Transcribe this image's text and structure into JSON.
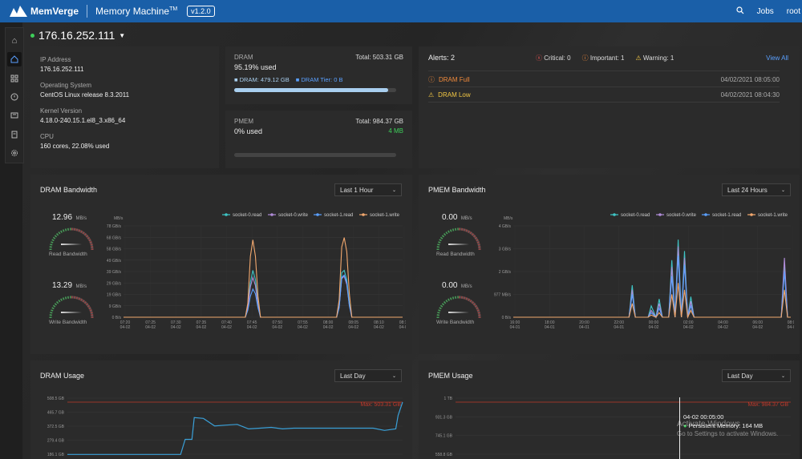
{
  "topbar": {
    "brand": "MemVerge",
    "app": "Memory Machine",
    "tm": "TM",
    "version": "v1.2.0",
    "jobs": "Jobs",
    "user": "root"
  },
  "host": {
    "ip": "176.16.252.111"
  },
  "info": {
    "ip_label": "IP Address",
    "ip": "176.16.252.111",
    "os_label": "Operating System",
    "os": "CentOS Linux release 8.3.2011",
    "kernel_label": "Kernel Version",
    "kernel": "4.18.0-240.15.1.el8_3.x86_64",
    "cpu_label": "CPU",
    "cpu": "160 cores, 22.08% used"
  },
  "dram": {
    "label": "DRAM",
    "total": "Total: 503.31 GB",
    "used": "95.19% used",
    "dram_leg": "DRAM: 479.12 GB",
    "tier_leg": "DRAM Tier: 0 B",
    "fill": 0.9519
  },
  "pmem": {
    "label": "PMEM",
    "total": "Total: 984.37 GB",
    "used": "0% used",
    "free": "4 MB",
    "fill": 0.0
  },
  "alerts": {
    "title": "Alerts: 2",
    "critical": "Critical: 0",
    "important": "Important: 1",
    "warning": "Warning: 1",
    "view_all": "View All",
    "items": [
      {
        "name": "DRAM Full",
        "time": "04/02/2021 08:05:00"
      },
      {
        "name": "DRAM Low",
        "time": "04/02/2021 08:04:30"
      }
    ]
  },
  "dram_bw": {
    "title": "DRAM Bandwidth",
    "range": "Last 1 Hour",
    "read_val": "12.96",
    "read_unit": "MB/s",
    "read_label": "Read Bandwidth",
    "write_val": "13.29",
    "write_unit": "MB/s",
    "write_label": "Write Bandwidth"
  },
  "pmem_bw": {
    "title": "PMEM Bandwidth",
    "range": "Last 24 Hours",
    "read_val": "0.00",
    "read_unit": "MB/s",
    "read_label": "Read Bandwidth",
    "write_val": "0.00",
    "write_unit": "MB/s",
    "write_label": "Write Bandwidth"
  },
  "dram_usage": {
    "title": "DRAM Usage",
    "range": "Last Day",
    "max_label": "Max: 503.31 GB"
  },
  "pmem_usage": {
    "title": "PMEM Usage",
    "range": "Last Day",
    "max_label": "Max: 984.37 GB",
    "tooltip_time": "04-02 00:05:00",
    "tooltip_val": "Persistent Memory: 164 MB"
  },
  "watermark": {
    "line1": "Activate Windows",
    "line2": "Go to Settings to activate Windows."
  },
  "colors": {
    "topbar": "#1a5fa8",
    "s0read": "#3ec6c6",
    "s0write": "#b08cd8",
    "s1read": "#5aa0ff",
    "s1write": "#f2a86e",
    "maxline": "#c0392b"
  },
  "chart_data": [
    {
      "type": "line",
      "title": "DRAM Bandwidth",
      "ylabel": "MB/s",
      "ylim": [
        0,
        78
      ],
      "yticks": [
        "0 B/s",
        "9 GB/s",
        "19 GB/s",
        "29 GB/s",
        "39 GB/s",
        "49 GB/s",
        "58 GB/s",
        "68 GB/s",
        "78 GB/s"
      ],
      "xticks": [
        "07:20\n04-02",
        "07:25\n04-02",
        "07:30\n04-02",
        "07:35\n04-02",
        "07:40\n04-02",
        "07:45\n04-02",
        "07:50\n04-02",
        "07:55\n04-02",
        "08:00\n04-02",
        "08:05\n04-02",
        "08:10\n04-02",
        "08:15\n04-02"
      ],
      "x": [
        0,
        5,
        10,
        15,
        20,
        24,
        24.5,
        25,
        25.5,
        26,
        26.5,
        27,
        30,
        35,
        40,
        42,
        42.5,
        43,
        43.5,
        44,
        44.5,
        45,
        48,
        55
      ],
      "series": [
        {
          "name": "socket-0.read",
          "values": [
            0,
            0,
            0,
            0,
            0,
            0,
            10,
            30,
            40,
            32,
            12,
            0,
            0,
            0,
            0,
            0,
            10,
            38,
            40,
            32,
            12,
            0,
            0,
            0
          ]
        },
        {
          "name": "socket-0.write",
          "values": [
            0,
            0,
            0,
            0,
            0,
            0,
            8,
            26,
            34,
            27,
            10,
            0,
            0,
            0,
            0,
            0,
            9,
            33,
            35,
            28,
            10,
            0,
            0,
            0
          ]
        },
        {
          "name": "socket-1.read",
          "values": [
            0,
            0,
            0,
            0,
            0,
            0,
            6,
            18,
            24,
            20,
            8,
            0,
            0,
            0,
            0,
            0,
            8,
            34,
            36,
            30,
            10,
            0,
            0,
            0
          ]
        },
        {
          "name": "socket-1.write",
          "values": [
            0,
            0,
            0,
            0,
            0,
            0,
            12,
            52,
            66,
            52,
            18,
            0,
            0,
            0,
            0,
            0,
            15,
            60,
            68,
            56,
            20,
            0,
            0,
            0
          ]
        }
      ]
    },
    {
      "type": "line",
      "title": "PMEM Bandwidth",
      "ylabel": "MB/s",
      "ylim": [
        0,
        4
      ],
      "yticks": [
        "0 B/s",
        "977 MB/s",
        "2 GB/s",
        "3 GB/s",
        "4 GB/s"
      ],
      "xticks": [
        "16:00\n04-01",
        "18:00\n04-01",
        "20:00\n04-01",
        "22:00\n04-01",
        "00:00\n04-02",
        "02:00\n04-02",
        "04:00\n04-02",
        "06:00\n04-02",
        "08:00\n04-02"
      ],
      "x": [
        0,
        7.3,
        7.5,
        7.7,
        8,
        8.5,
        8.7,
        9,
        9.2,
        9.4,
        9.8,
        10,
        10.2,
        10.4,
        10.6,
        10.8,
        11,
        11.2,
        11.4,
        16.9,
        17.1,
        17.3,
        17.5
      ],
      "series": [
        {
          "name": "socket-0.read",
          "values": [
            0,
            0,
            1.4,
            0,
            0,
            0,
            0.5,
            0,
            0.8,
            0,
            0,
            2.5,
            0,
            3.4,
            0,
            2.9,
            0,
            0.9,
            0,
            0,
            2.2,
            0,
            0
          ]
        },
        {
          "name": "socket-0.write",
          "values": [
            0,
            0,
            1.2,
            0,
            0,
            0,
            0.3,
            0,
            0.6,
            0,
            0,
            2.2,
            0,
            3.1,
            0,
            2.6,
            0,
            0.7,
            0,
            0,
            2.6,
            0,
            0
          ]
        },
        {
          "name": "socket-1.read",
          "values": [
            0,
            0,
            1.0,
            0,
            0,
            0,
            0.2,
            0,
            0.4,
            0,
            0,
            1.8,
            0,
            2.7,
            0,
            2.3,
            0,
            0.5,
            0,
            0,
            2.0,
            0,
            0
          ]
        },
        {
          "name": "socket-1.write",
          "values": [
            0,
            0,
            0.6,
            0,
            0,
            0,
            0.1,
            0,
            0.2,
            0,
            0,
            1.0,
            0,
            1.5,
            0,
            1.2,
            0,
            0.3,
            0,
            0,
            1.2,
            0,
            0
          ]
        }
      ]
    },
    {
      "type": "line",
      "title": "DRAM Usage",
      "ylim": [
        0,
        520
      ],
      "yticks": [
        "186.1 GB",
        "279.4 GB",
        "372.5 GB",
        "465.7 GB",
        "508.5 GB"
      ],
      "x": [
        0,
        5,
        5.2,
        5.5,
        5.6,
        6,
        6.5,
        7,
        7.5,
        8,
        8.5,
        9,
        9.5,
        10,
        12,
        13.5,
        14,
        14.5,
        14.6,
        14.8
      ],
      "series": [
        {
          "name": "",
          "values": [
            160,
            160,
            260,
            260,
            405,
            400,
            350,
            355,
            360,
            330,
            335,
            340,
            330,
            335,
            335,
            335,
            320,
            330,
            420,
            508
          ]
        }
      ]
    },
    {
      "type": "line",
      "title": "PMEM Usage",
      "ylim": [
        0,
        1000
      ],
      "yticks": [
        "558.8 GB",
        "745.1 GB",
        "931.3 GB",
        "1 TB"
      ],
      "series": []
    }
  ]
}
